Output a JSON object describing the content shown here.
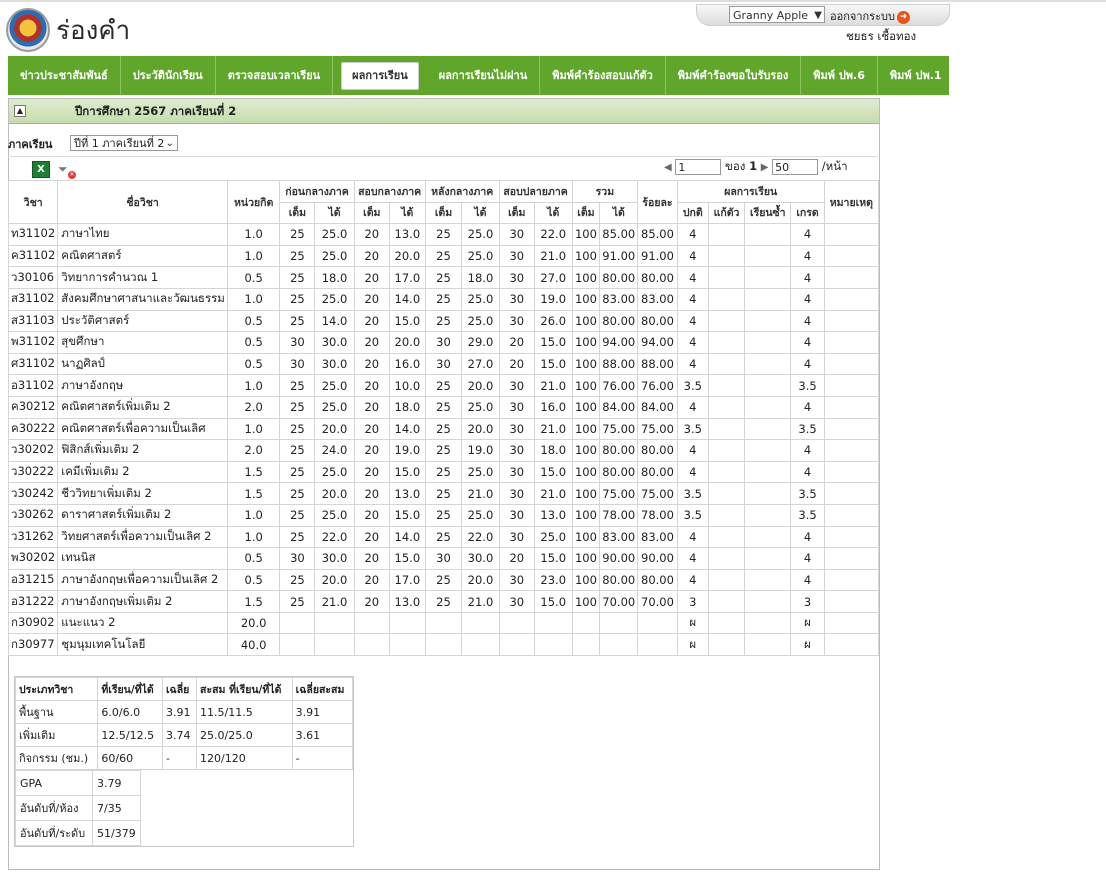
{
  "site": {
    "title": "ร่องคำ"
  },
  "user": {
    "theme": "Granny Apple",
    "logout_label": "ออกจากระบบ",
    "name": "ชยธร เชื้อทอง"
  },
  "nav": {
    "items": [
      {
        "label": "ข่าวประชาสัมพันธ์"
      },
      {
        "label": "ประวัตินักเรียน"
      },
      {
        "label": "ตรวจสอบเวลาเรียน"
      },
      {
        "label": "ผลการเรียน"
      },
      {
        "label": "ผลการเรียนไม่ผ่าน"
      },
      {
        "label": "พิมพ์คำร้องสอบแก้ตัว"
      },
      {
        "label": "พิมพ์คำร้องขอใบรับรอง"
      },
      {
        "label": "พิมพ์ ปพ.6"
      },
      {
        "label": "พิมพ์ ปพ.1"
      }
    ],
    "active": "ผลการเรียน"
  },
  "panel": {
    "title": "ปีการศึกษา 2567 ภาคเรียนที่ 2"
  },
  "filter": {
    "label": "ภาคเรียน",
    "value": "ปีที่ 1 ภาคเรียนที่ 2"
  },
  "pager": {
    "page": "1",
    "of_label": "ของ",
    "total_pages": "1",
    "page_size": "50",
    "per_page_label": "/หน้า"
  },
  "table": {
    "headers": {
      "subject": "วิชา",
      "subject_name": "ชื่อวิชา",
      "credits": "หน่วยกิต",
      "pre_mid": "ก่อนกลางภาค",
      "mid_exam": "สอบกลางภาค",
      "post_mid": "หลังกลางภาค",
      "final_exam": "สอบปลายภาค",
      "total": "รวม",
      "percent": "ร้อยละ",
      "result": "ผลการเรียน",
      "remark": "หมายเหตุ",
      "full": "เต็ม",
      "got": "ได้",
      "normal": "ปกติ",
      "fix": "แก้ตัว",
      "repeat": "เรียนซ้ำ",
      "grade": "เกรด"
    },
    "rows": [
      [
        "ท31102",
        "ภาษาไทย",
        "1.0",
        "25",
        "25.0",
        "20",
        "13.0",
        "25",
        "25.0",
        "30",
        "22.0",
        "100",
        "85.00",
        "85.00",
        "4",
        "",
        "",
        "4",
        ""
      ],
      [
        "ค31102",
        "คณิตศาสตร์",
        "1.0",
        "25",
        "25.0",
        "20",
        "20.0",
        "25",
        "25.0",
        "30",
        "21.0",
        "100",
        "91.00",
        "91.00",
        "4",
        "",
        "",
        "4",
        ""
      ],
      [
        "ว30106",
        "วิทยาการคำนวณ 1",
        "0.5",
        "25",
        "18.0",
        "20",
        "17.0",
        "25",
        "18.0",
        "30",
        "27.0",
        "100",
        "80.00",
        "80.00",
        "4",
        "",
        "",
        "4",
        ""
      ],
      [
        "ส31102",
        "สังคมศึกษาศาสนาและวัฒนธรรม",
        "1.0",
        "25",
        "25.0",
        "20",
        "14.0",
        "25",
        "25.0",
        "30",
        "19.0",
        "100",
        "83.00",
        "83.00",
        "4",
        "",
        "",
        "4",
        ""
      ],
      [
        "ส31103",
        "ประวัติศาสตร์",
        "0.5",
        "25",
        "14.0",
        "20",
        "15.0",
        "25",
        "25.0",
        "30",
        "26.0",
        "100",
        "80.00",
        "80.00",
        "4",
        "",
        "",
        "4",
        ""
      ],
      [
        "พ31102",
        "สุขศึกษา",
        "0.5",
        "30",
        "30.0",
        "20",
        "20.0",
        "30",
        "29.0",
        "20",
        "15.0",
        "100",
        "94.00",
        "94.00",
        "4",
        "",
        "",
        "4",
        ""
      ],
      [
        "ศ31102",
        "นาฏศิลป์",
        "0.5",
        "30",
        "30.0",
        "20",
        "16.0",
        "30",
        "27.0",
        "20",
        "15.0",
        "100",
        "88.00",
        "88.00",
        "4",
        "",
        "",
        "4",
        ""
      ],
      [
        "อ31102",
        "ภาษาอังกฤษ",
        "1.0",
        "25",
        "25.0",
        "20",
        "10.0",
        "25",
        "20.0",
        "30",
        "21.0",
        "100",
        "76.00",
        "76.00",
        "3.5",
        "",
        "",
        "3.5",
        ""
      ],
      [
        "ค30212",
        "คณิตศาสตร์เพิ่มเติม 2",
        "2.0",
        "25",
        "25.0",
        "20",
        "18.0",
        "25",
        "25.0",
        "30",
        "16.0",
        "100",
        "84.00",
        "84.00",
        "4",
        "",
        "",
        "4",
        ""
      ],
      [
        "ค30222",
        "คณิตศาสตร์เพื่อความเป็นเลิศ",
        "1.0",
        "25",
        "20.0",
        "20",
        "14.0",
        "25",
        "20.0",
        "30",
        "21.0",
        "100",
        "75.00",
        "75.00",
        "3.5",
        "",
        "",
        "3.5",
        ""
      ],
      [
        "ว30202",
        "ฟิสิกส์เพิ่มเติม 2",
        "2.0",
        "25",
        "24.0",
        "20",
        "19.0",
        "25",
        "19.0",
        "30",
        "18.0",
        "100",
        "80.00",
        "80.00",
        "4",
        "",
        "",
        "4",
        ""
      ],
      [
        "ว30222",
        "เคมีเพิ่มเติม 2",
        "1.5",
        "25",
        "25.0",
        "20",
        "15.0",
        "25",
        "25.0",
        "30",
        "15.0",
        "100",
        "80.00",
        "80.00",
        "4",
        "",
        "",
        "4",
        ""
      ],
      [
        "ว30242",
        "ชีววิทยาเพิ่มเติม 2",
        "1.5",
        "25",
        "20.0",
        "20",
        "13.0",
        "25",
        "21.0",
        "30",
        "21.0",
        "100",
        "75.00",
        "75.00",
        "3.5",
        "",
        "",
        "3.5",
        ""
      ],
      [
        "ว30262",
        "ดาราศาสตร์เพิ่มเติม 2",
        "1.0",
        "25",
        "25.0",
        "20",
        "15.0",
        "25",
        "25.0",
        "30",
        "13.0",
        "100",
        "78.00",
        "78.00",
        "3.5",
        "",
        "",
        "3.5",
        ""
      ],
      [
        "ว31262",
        "วิทยศาสตร์เพื่อความเป็นเลิศ 2",
        "1.0",
        "25",
        "22.0",
        "20",
        "14.0",
        "25",
        "22.0",
        "30",
        "25.0",
        "100",
        "83.00",
        "83.00",
        "4",
        "",
        "",
        "4",
        ""
      ],
      [
        "พ30202",
        "เทนนิส",
        "0.5",
        "30",
        "30.0",
        "20",
        "15.0",
        "30",
        "30.0",
        "20",
        "15.0",
        "100",
        "90.00",
        "90.00",
        "4",
        "",
        "",
        "4",
        ""
      ],
      [
        "อ31215",
        "ภาษาอังกฤษเพื่อความเป็นเลิศ 2",
        "0.5",
        "25",
        "20.0",
        "20",
        "17.0",
        "25",
        "20.0",
        "30",
        "23.0",
        "100",
        "80.00",
        "80.00",
        "4",
        "",
        "",
        "4",
        ""
      ],
      [
        "อ31222",
        "ภาษาอังกฤษเพิ่มเติม 2",
        "1.5",
        "25",
        "21.0",
        "20",
        "13.0",
        "25",
        "21.0",
        "30",
        "15.0",
        "100",
        "70.00",
        "70.00",
        "3",
        "",
        "",
        "3",
        ""
      ],
      [
        "ก30902",
        "แนะแนว 2",
        "20.0",
        "",
        "",
        "",
        "",
        "",
        "",
        "",
        "",
        "",
        "",
        "",
        "ผ",
        "",
        "",
        "ผ",
        ""
      ],
      [
        "ก30977",
        "ชุมนุมเทคโนโลยี",
        "40.0",
        "",
        "",
        "",
        "",
        "",
        "",
        "",
        "",
        "",
        "",
        "",
        "ผ",
        "",
        "",
        "ผ",
        ""
      ]
    ]
  },
  "summary": {
    "headers": [
      "ประเภทวิชา",
      "ที่เรียน/ที่ได้",
      "เฉลี่ย",
      "สะสม ที่เรียน/ที่ได้",
      "เฉลี่ยสะสม"
    ],
    "rows": [
      [
        "พื้นฐาน",
        "6.0/6.0",
        "3.91",
        "11.5/11.5",
        "3.91"
      ],
      [
        "เพิ่มเติม",
        "12.5/12.5",
        "3.74",
        "25.0/25.0",
        "3.61"
      ],
      [
        "กิจกรรม (ชม.)",
        "60/60",
        "-",
        "120/120",
        "-"
      ]
    ],
    "stats": [
      [
        "GPA",
        "3.79"
      ],
      [
        "อันดับที่/ห้อง",
        "7/35"
      ],
      [
        "อันดับที่/ระดับ",
        "51/379"
      ]
    ]
  }
}
